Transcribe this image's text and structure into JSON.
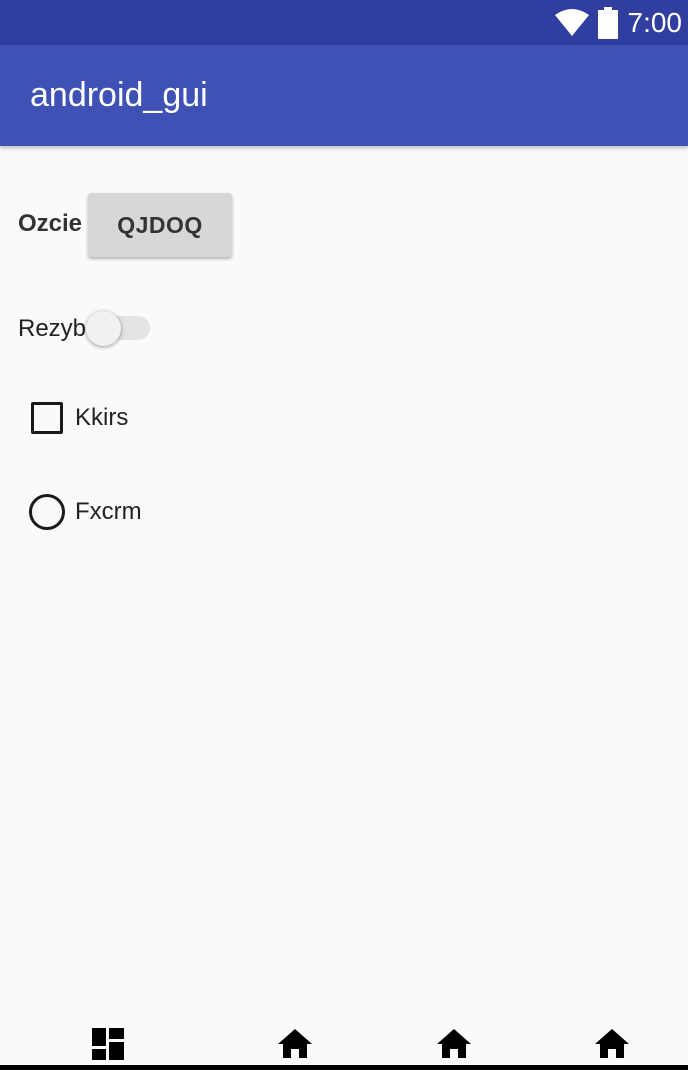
{
  "status_bar": {
    "time": "7:00",
    "icons": [
      "wifi-icon",
      "battery-icon"
    ]
  },
  "app_bar": {
    "title": "android_gui"
  },
  "form": {
    "ozcie_label": "Ozcie",
    "qjdoq_button": "QJDOQ",
    "rezyb_label": "Rezyb",
    "rezyb_switch_on": false,
    "kkirs_label": "Kkirs",
    "kkirs_checked": false,
    "fxcrm_label": "Fxcrm",
    "fxcrm_selected": false
  },
  "bottom_nav": {
    "items": [
      "dashboard-icon",
      "home-icon",
      "home-icon",
      "home-icon"
    ]
  },
  "colors": {
    "status_bar": "#303f9f",
    "app_bar": "#3f51b5",
    "background": "#fafafa"
  }
}
